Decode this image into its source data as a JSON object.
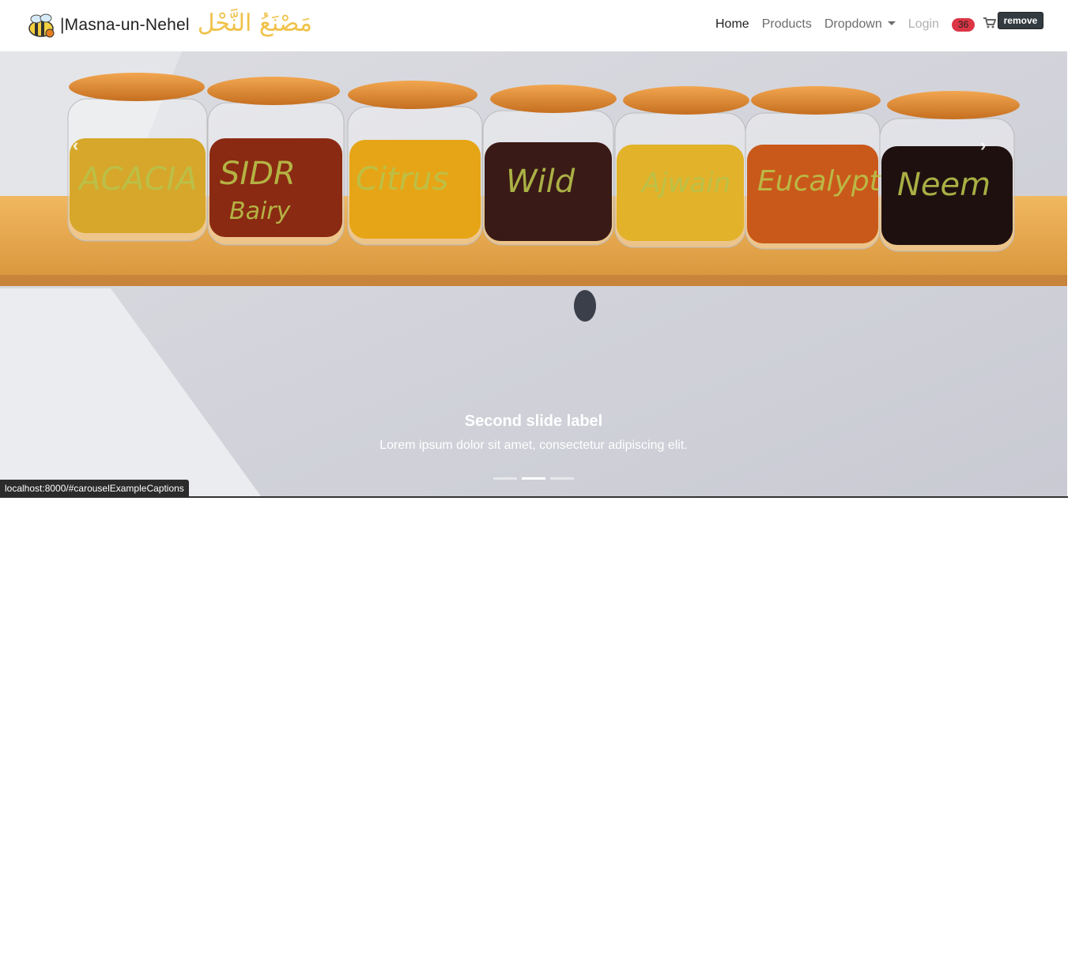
{
  "brand": {
    "name": "|Masna-un-Nehel",
    "arabic": "مَصْنَعُ النَّحْل"
  },
  "nav": {
    "home": "Home",
    "products": "Products",
    "dropdown": "Dropdown",
    "login": "Login",
    "cart_count": "36",
    "remove": "remove"
  },
  "carousel": {
    "jar_labels": [
      "ACACIA",
      "SIDR",
      "Citrus",
      "Wild",
      "Ajwain",
      "Eucalypt",
      "Neem"
    ],
    "jar_sublabel": "Bairy",
    "caption_title": "Second slide label",
    "caption_text": "Lorem ipsum dolor sit amet, consectetur adipiscing elit.",
    "indicators": 3,
    "active_index": 1
  },
  "status_url": "localhost:8000/#carouselExampleCaptions",
  "colors": {
    "accent_badge": "#dc3545",
    "brand_gold": "#f0c24a",
    "shelf": "#e7a94b"
  }
}
